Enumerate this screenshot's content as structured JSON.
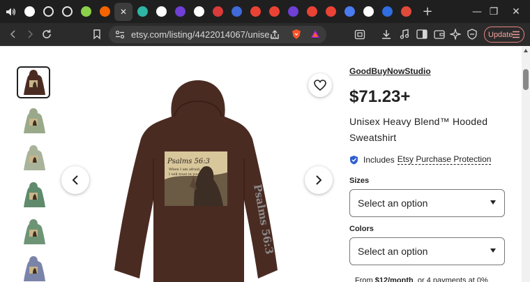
{
  "browser": {
    "tabs": [
      {
        "name": "audio-tab",
        "icon": "speaker-icon",
        "bg": "#1f1f1f",
        "glyph": "🔊",
        "active": false
      },
      {
        "name": "tab-2",
        "icon": "dark-circle-icon",
        "bg": "#ffffff",
        "glyph": "●",
        "active": false
      },
      {
        "name": "tab-3",
        "icon": "ring-icon",
        "bg": "#1f1f1f",
        "glyph": "○",
        "active": false
      },
      {
        "name": "tab-4",
        "icon": "ring-icon",
        "bg": "#1f1f1f",
        "glyph": "○",
        "active": false
      },
      {
        "name": "tab-5",
        "icon": "green-p-icon",
        "bg": "#8bd14b",
        "glyph": "P",
        "active": false
      },
      {
        "name": "tab-6",
        "icon": "etsy-e-icon",
        "bg": "#f56400",
        "glyph": "E",
        "active": false
      },
      {
        "name": "tab-etsy-active",
        "icon": "close-icon",
        "bg": "transparent",
        "glyph": "✕",
        "active": true
      },
      {
        "name": "tab-8",
        "icon": "h-icon",
        "bg": "#2fb5a5",
        "glyph": "h",
        "active": false
      },
      {
        "name": "tab-9",
        "icon": "m-icon",
        "bg": "#ffffff",
        "glyph": "m",
        "active": false
      },
      {
        "name": "tab-10",
        "icon": "purple-icon",
        "bg": "#6f3fd6",
        "glyph": "◑",
        "active": false
      },
      {
        "name": "tab-11",
        "icon": "grid-icon",
        "bg": "#ffffff",
        "glyph": "⊞",
        "active": false
      },
      {
        "name": "tab-12",
        "icon": "red-icon",
        "bg": "#d93b3b",
        "glyph": "◐",
        "active": false
      },
      {
        "name": "tab-13",
        "icon": "search-icon",
        "bg": "#3f6ad8",
        "glyph": "◎",
        "active": false
      },
      {
        "name": "tab-14",
        "icon": "gmail-icon",
        "bg": "#ea4335",
        "glyph": "M",
        "active": false
      },
      {
        "name": "tab-15",
        "icon": "gmail-icon",
        "bg": "#ea4335",
        "glyph": "M",
        "active": false
      },
      {
        "name": "tab-16",
        "icon": "purple-icon",
        "bg": "#6f3fd6",
        "glyph": "◑",
        "active": false
      },
      {
        "name": "tab-17",
        "icon": "gmail-icon",
        "bg": "#ea4335",
        "glyph": "M",
        "active": false
      },
      {
        "name": "tab-18",
        "icon": "gmail-icon",
        "bg": "#ea4335",
        "glyph": "M",
        "active": false
      },
      {
        "name": "tab-19",
        "icon": "gemini-icon",
        "bg": "#4a7cf0",
        "glyph": "✦",
        "active": false
      },
      {
        "name": "tab-20",
        "icon": "dots-icon",
        "bg": "#ffffff",
        "glyph": "•••",
        "active": false
      },
      {
        "name": "tab-21",
        "icon": "blue-circle-icon",
        "bg": "#2f6de0",
        "glyph": "●",
        "active": false
      },
      {
        "name": "tab-22",
        "icon": "red-circle-icon",
        "bg": "#e04a3a",
        "glyph": "●",
        "active": false
      }
    ],
    "new_tab": "+",
    "minimize": "—",
    "restore": "❐",
    "close": "✕",
    "url": "etsy.com/listing/4422014067/unise...",
    "update_label": "Update"
  },
  "listing": {
    "shop_name": "GoodBuyNowStudio",
    "price": "$71.23+",
    "title": "Unisex Heavy Blend™ Hooded Sweatshirt",
    "protection_prefix": "Includes",
    "protection_link": "Etsy Purchase Protection",
    "sizes_label": "Sizes",
    "sizes_value": "Select an option",
    "colors_label": "Colors",
    "colors_value": "Select an option",
    "klarna_prefix": "From ",
    "klarna_amount": "$12/month",
    "klarna_suffix": ", or 4 payments at 0%"
  },
  "product_image": {
    "print_title": "Psalms 56:3",
    "print_verse_line1": "When I am afraid,",
    "print_verse_line2": "I will trust in you.",
    "sleeve_text": "Psalms 56:3",
    "hoodie_color": "#4a2b22"
  },
  "thumbnails": [
    {
      "color": "#4a2b22"
    },
    {
      "color": "#9aa98a"
    },
    {
      "color": "#a9b39a"
    },
    {
      "color": "#5f8a6c"
    },
    {
      "color": "#6e9476"
    },
    {
      "color": "#7a83a8"
    }
  ],
  "colors": {
    "tab_bar": "#1f1f1f",
    "nav_bar": "#2b2b2b",
    "update_accent": "#e98580",
    "protection_badge": "#2f5fd0"
  }
}
